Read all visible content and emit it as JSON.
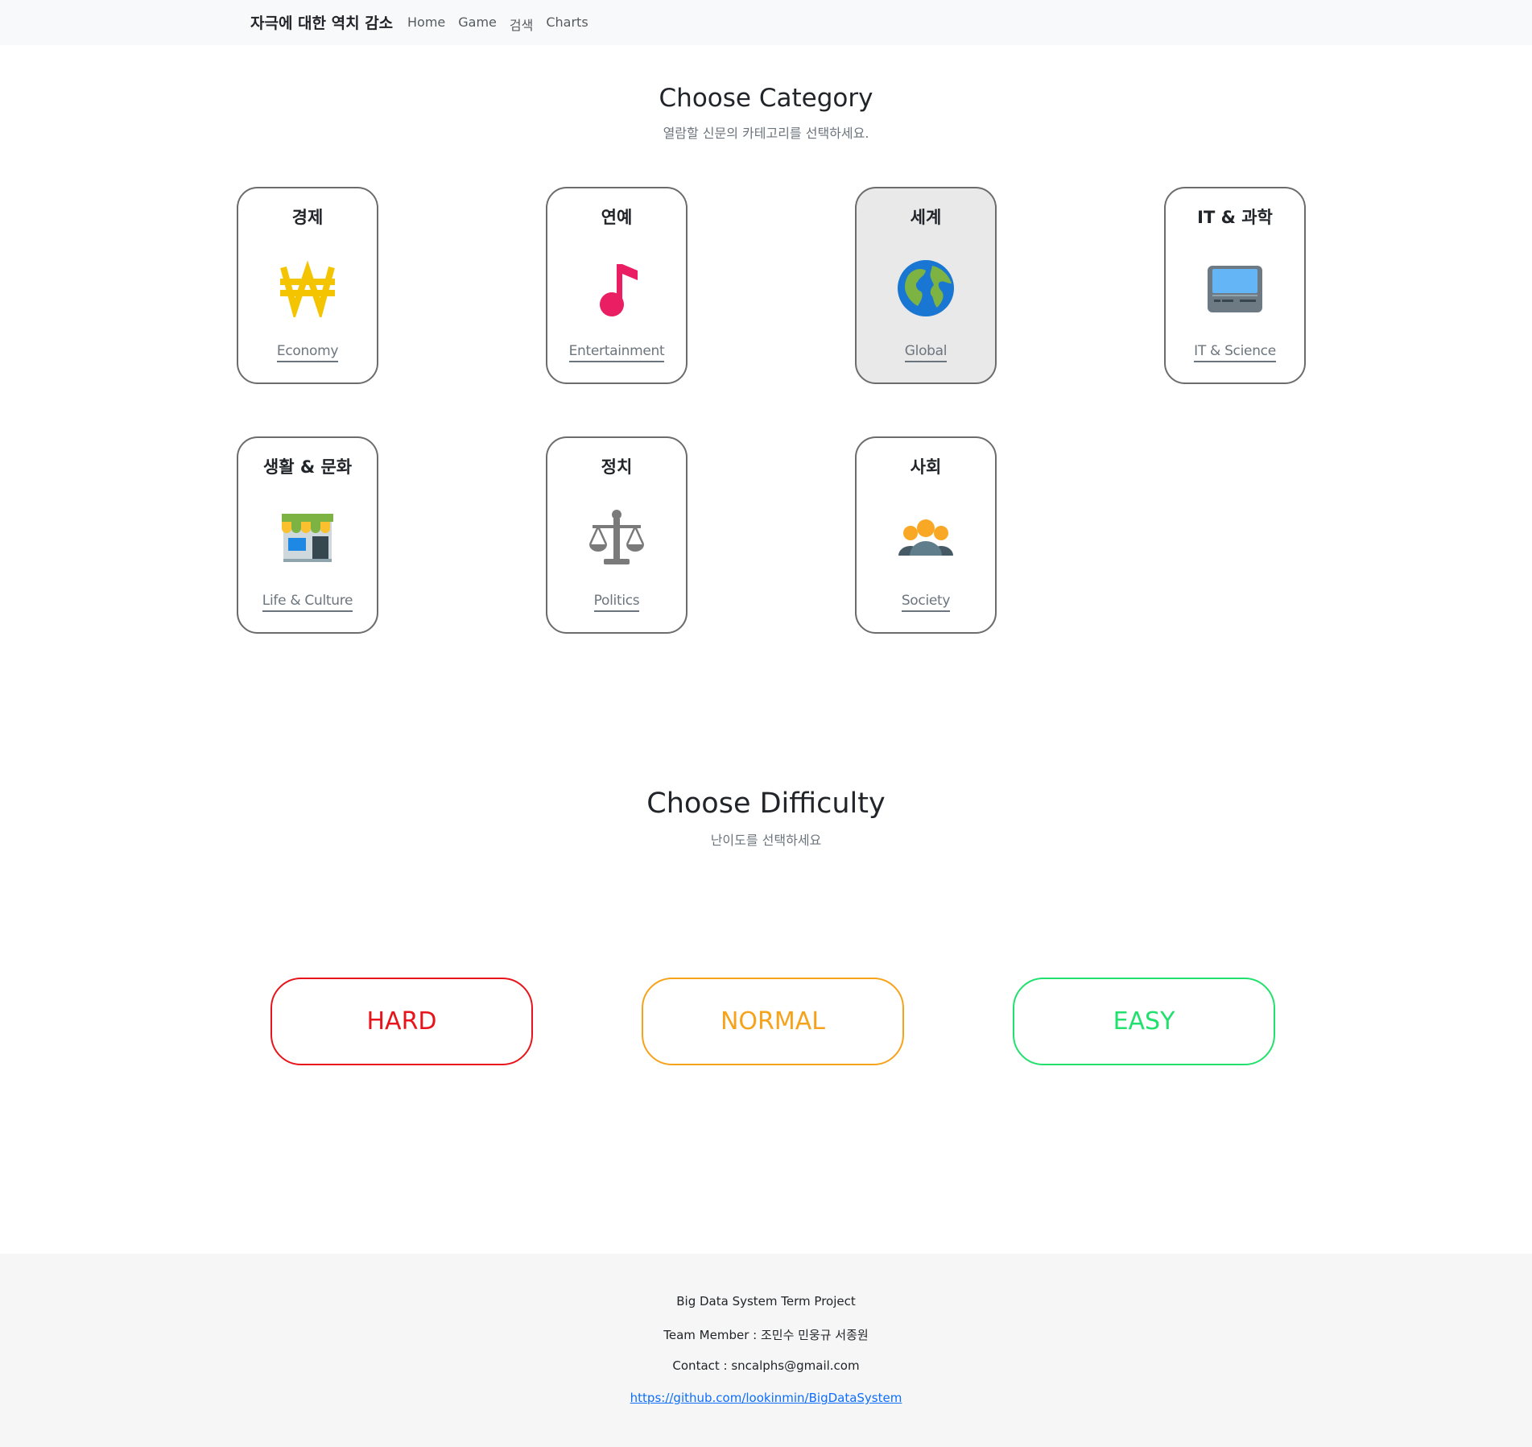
{
  "navbar": {
    "brand": "자극에 대한 역치 감소",
    "links": [
      "Home",
      "Game",
      "검색",
      "Charts"
    ]
  },
  "category_section": {
    "title": "Choose Category",
    "subtitle": "열람할 신문의 카테고리를 선택하세요."
  },
  "categories": [
    {
      "kr": "경제",
      "en": "Economy",
      "icon": "won-icon"
    },
    {
      "kr": "연예",
      "en": "Entertainment",
      "icon": "music-note-icon"
    },
    {
      "kr": "세계",
      "en": "Global",
      "icon": "globe-icon",
      "selected": true
    },
    {
      "kr": "IT & 과학",
      "en": "IT & Science",
      "icon": "laptop-icon"
    },
    {
      "kr": "생활 & 문화",
      "en": "Life & Culture",
      "icon": "store-icon"
    },
    {
      "kr": "정치",
      "en": "Politics",
      "icon": "scales-icon"
    },
    {
      "kr": "사회",
      "en": "Society",
      "icon": "people-icon"
    }
  ],
  "difficulty_section": {
    "title": "Choose Difficulty",
    "subtitle": "난이도를 선택하세요"
  },
  "difficulties": [
    {
      "label": "HARD",
      "color": "#e8141b"
    },
    {
      "label": "NORMAL",
      "color": "#f7a21b"
    },
    {
      "label": "EASY",
      "color": "#22e06d"
    }
  ],
  "footer": {
    "project": "Big Data System Term Project",
    "team": "Team Member : 조민수 민웅규 서종원",
    "contact": "Contact : sncalphs@gmail.com",
    "repo": "https://github.com/lookinmin/BigDataSystem"
  }
}
